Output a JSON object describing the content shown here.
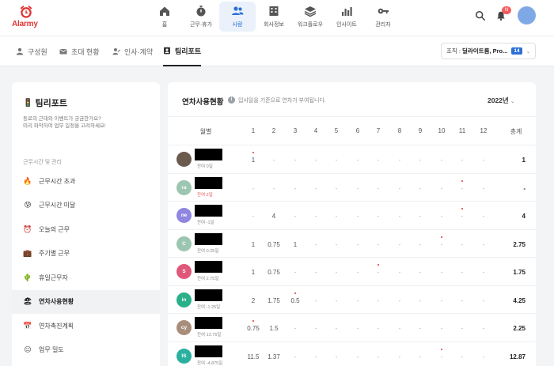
{
  "app": {
    "logo_text": "Alarmy"
  },
  "nav": [
    {
      "label": "홈",
      "icon": "home-icon",
      "active": false
    },
    {
      "label": "근무·휴가",
      "icon": "stopwatch-icon",
      "active": false
    },
    {
      "label": "사람",
      "icon": "people-icon",
      "active": true
    },
    {
      "label": "회사정보",
      "icon": "building-icon",
      "active": false
    },
    {
      "label": "워크플로우",
      "icon": "layers-icon",
      "active": false
    },
    {
      "label": "인사이트",
      "icon": "bar-chart-icon",
      "active": false
    },
    {
      "label": "관리자",
      "icon": "key-icon",
      "active": false
    }
  ],
  "header": {
    "notification_badge": "N"
  },
  "subtabs": [
    {
      "label": "구성원",
      "icon": "person-icon",
      "active": false
    },
    {
      "label": "초대 현황",
      "icon": "mail-icon",
      "active": false
    },
    {
      "label": "인사·계약",
      "icon": "person-edit-icon",
      "active": false
    },
    {
      "label": "팀리포트",
      "icon": "id-badge-icon",
      "active": true
    }
  ],
  "org_select": {
    "prefix": "조직 :",
    "value": "딜라이트룸, Pro...",
    "count": "14"
  },
  "left": {
    "title": "팀리포트",
    "desc_line1": "동료의 근태와 이벤트가 궁금한가요?",
    "desc_line2": "미리 파악하여 업무 일정을 고려하세요!",
    "section": "근무시간 및 관리",
    "items": [
      {
        "label": "근무시간 초과",
        "emoji": "🔥"
      },
      {
        "label": "근무시간 미달",
        "emoji": "😰"
      },
      {
        "label": "오늘의 근무",
        "emoji": "⏰"
      },
      {
        "label": "주기별 근무",
        "emoji": "💼"
      },
      {
        "label": "휴일근무자",
        "emoji": "🌵"
      },
      {
        "label": "연차사용현황",
        "emoji": "🏖"
      },
      {
        "label": "연차촉진계획",
        "emoji": "📅"
      },
      {
        "label": "업무 밀도",
        "emoji": "😑"
      }
    ]
  },
  "main": {
    "title": "연차사용현황",
    "info_icon": "i",
    "desc": "입사일을 기준으로 연차가 부여됩니다.",
    "year": "2022년",
    "year_chevron": "⌄",
    "header": {
      "month_label": "월별",
      "months": [
        "1",
        "2",
        "3",
        "4",
        "5",
        "6",
        "7",
        "8",
        "9",
        "10",
        "11",
        "12"
      ],
      "total_label": "총계"
    },
    "rows": [
      {
        "initials": "",
        "color": "#6b5a4e",
        "sub": "잔여 0일",
        "sub_red": false,
        "cells": [
          "1",
          "-",
          "-",
          "-",
          "-",
          "-",
          "-",
          "-",
          "-",
          "-",
          "-",
          "-"
        ],
        "total": "1"
      },
      {
        "initials": "ra",
        "color": "#9cc5b2",
        "sub": "잔여 2일",
        "sub_red": true,
        "cells": [
          "-",
          "-",
          "-",
          "-",
          "-",
          "-",
          "-",
          "-",
          "-",
          "-",
          "-",
          "-"
        ],
        "total": "-"
      },
      {
        "initials": "ne",
        "color": "#8f86e0",
        "sub": "잔여 -1일",
        "sub_red": false,
        "cells": [
          "-",
          "4",
          "-",
          "-",
          "-",
          "-",
          "-",
          "-",
          "-",
          "-",
          "-",
          "-"
        ],
        "total": "4"
      },
      {
        "initials": "C",
        "color": "#9cc5b2",
        "sub": "잔여 0.25일",
        "sub_red": false,
        "cells": [
          "1",
          "0.75",
          "1",
          "-",
          "-",
          "-",
          "-",
          "-",
          "-",
          "-",
          "-",
          "-"
        ],
        "total": "2.75"
      },
      {
        "initials": "S",
        "color": "#e0577a",
        "sub": "잔여 2.75일",
        "sub_red": false,
        "cells": [
          "1",
          "0.75",
          "-",
          "-",
          "-",
          "-",
          "-",
          "-",
          "-",
          "-",
          "-",
          "-"
        ],
        "total": "1.75"
      },
      {
        "initials": "in",
        "color": "#2bb08a",
        "sub": "잔여 -1.25일",
        "sub_red": false,
        "cells": [
          "2",
          "1.75",
          "0.5",
          "-",
          "-",
          "-",
          "-",
          "-",
          "-",
          "-",
          "-",
          "-"
        ],
        "total": "4.25"
      },
      {
        "initials": "cy",
        "color": "#a88e7a",
        "sub": "잔여 12.75일",
        "sub_red": false,
        "cells": [
          "0.75",
          "1.5",
          "-",
          "-",
          "-",
          "-",
          "-",
          "-",
          "-",
          "-",
          "-",
          "-"
        ],
        "total": "2.25"
      },
      {
        "initials": "IS",
        "color": "#2bb0a0",
        "sub": "잔여 -4.875일",
        "sub_red": false,
        "cells": [
          "11.5",
          "1.37",
          "-",
          "-",
          "-",
          "-",
          "-",
          "-",
          "-",
          "-",
          "-",
          "-"
        ],
        "total": "12.87"
      }
    ]
  }
}
